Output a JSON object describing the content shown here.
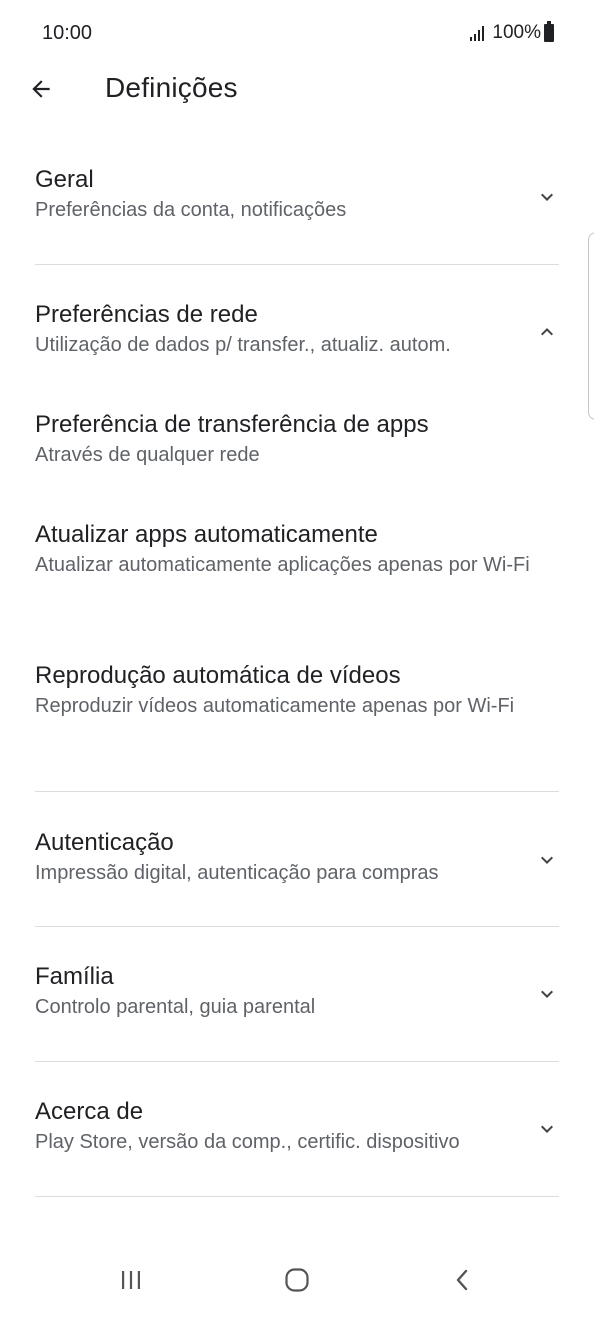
{
  "status_bar": {
    "time": "10:00",
    "battery": "100%",
    "icons": [
      "signal-icon",
      "battery-icon"
    ]
  },
  "app_bar": {
    "title": "Definições",
    "back_icon": "arrow-back-icon"
  },
  "sections": [
    {
      "title": "Geral",
      "subtitle": "Preferências da conta, notificações",
      "expanded": false
    },
    {
      "title": "Preferências de rede",
      "subtitle": "Utilização de dados p/ transfer., atualiz. autom.",
      "expanded": true,
      "items": [
        {
          "title": "Preferência de transferência de apps",
          "subtitle": "Através de qualquer rede"
        },
        {
          "title": "Atualizar apps automaticamente",
          "subtitle": "Atualizar automaticamente aplicações apenas por Wi-Fi"
        },
        {
          "title": "Reprodução automática de vídeos",
          "subtitle": "Reproduzir vídeos automaticamente apenas por Wi-Fi"
        }
      ]
    },
    {
      "title": "Autenticação",
      "subtitle": "Impressão digital, autenticação para compras",
      "expanded": false
    },
    {
      "title": "Família",
      "subtitle": "Controlo parental, guia parental",
      "expanded": false
    },
    {
      "title": "Acerca de",
      "subtitle": "Play Store, versão da comp., certific. dispositivo",
      "expanded": false
    }
  ],
  "nav_bar": {
    "icons": [
      "recent-apps-icon",
      "home-icon",
      "back-icon"
    ]
  },
  "colors": {
    "text_primary": "#202124",
    "text_secondary": "#5f6368",
    "divider": "#dadce0",
    "background": "#ffffff"
  }
}
